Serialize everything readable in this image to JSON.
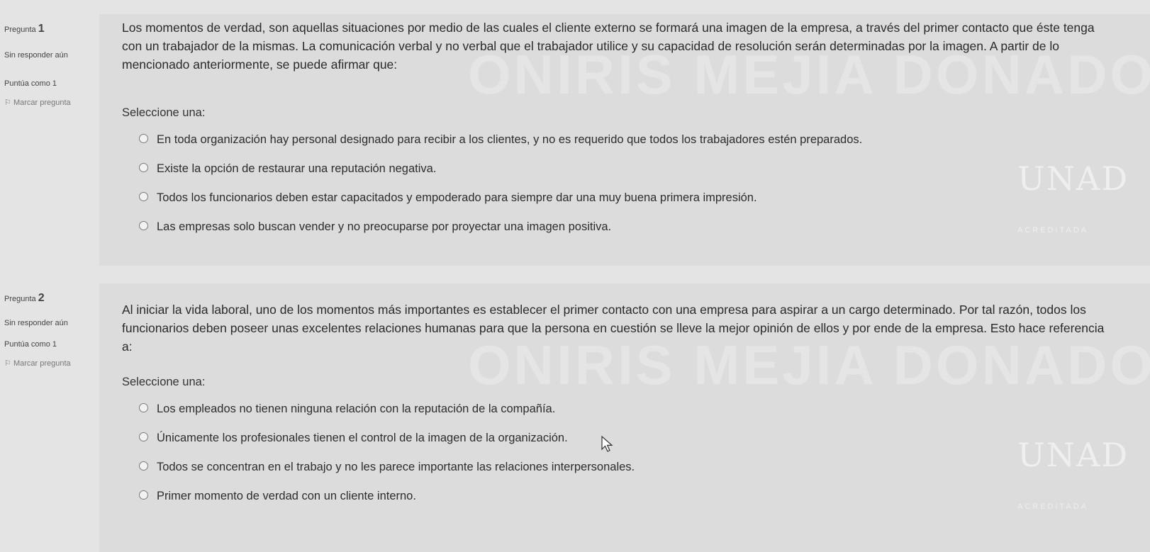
{
  "questions": [
    {
      "label": "Pregunta",
      "number": "1",
      "state": "Sin responder aún",
      "grade": "Puntúa como 1",
      "flag": "Marcar pregunta",
      "text": "Los momentos de verdad, son aquellas situaciones por medio de las cuales el cliente externo se formará una imagen de la empresa, a través del primer contacto que éste tenga con un trabajador de la mismas. La comunicación verbal y no verbal que el trabajador utilice y su capacidad de resolución serán determinadas por la imagen. A partir de lo mencionado anteriormente, se puede afirmar que:",
      "prompt": "Seleccione una:",
      "options": [
        "En toda organización hay personal designado para recibir a los clientes, y no es requerido que todos los trabajadores estén preparados.",
        "Existe la opción de restaurar una reputación negativa.",
        "Todos los funcionarios deben estar capacitados y empoderado para siempre dar una muy buena primera impresión.",
        "Las empresas solo buscan vender y no preocuparse por proyectar una imagen positiva."
      ]
    },
    {
      "label": "Pregunta",
      "number": "2",
      "state": "Sin responder aún",
      "grade": "Puntúa como 1",
      "flag": "Marcar pregunta",
      "text": "Al iniciar la vida laboral, uno de los momentos más importantes es establecer el primer contacto con una empresa para aspirar a un cargo determinado. Por tal razón, todos los funcionarios deben poseer unas excelentes relaciones humanas para que la persona en cuestión se lleve la mejor opinión de ellos y por ende de la empresa. Esto hace referencia a:",
      "prompt": "Seleccione una:",
      "options": [
        "Los empleados no tienen ninguna relación con la reputación de la compañía.",
        "Únicamente los profesionales tienen el control de la imagen de la organización.",
        "Todos se concentran en el trabajo y no les parece importante las relaciones interpersonales.",
        "Primer momento de verdad con un cliente interno."
      ]
    }
  ],
  "watermark": {
    "text": "ONIRIS MEJIA DONADO",
    "logo": "UNAD",
    "accredited": "ACREDITADA"
  },
  "icons": {
    "flag": "flag-icon",
    "radio": "radio-icon",
    "cursor": "mouse-pointer-icon"
  },
  "colors": {
    "background": "#e4e4e4",
    "formulation": "#dcdcdc"
  }
}
